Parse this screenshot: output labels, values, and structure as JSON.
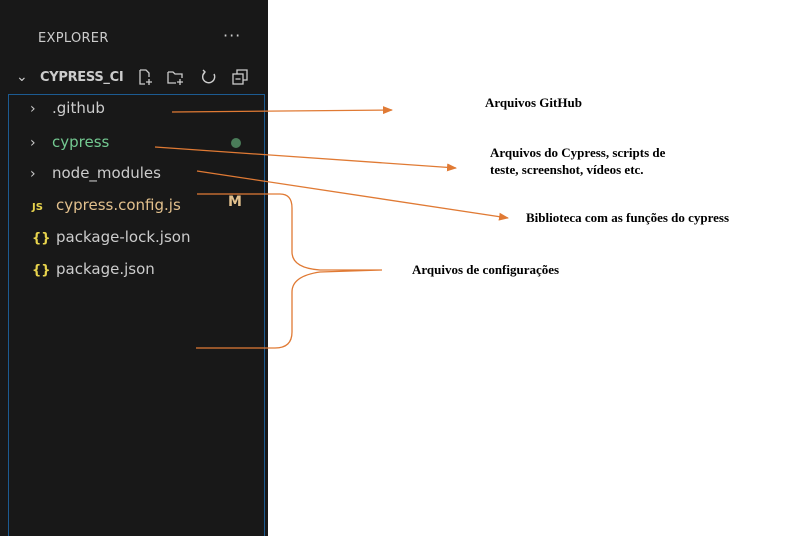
{
  "explorer": {
    "title": "EXPLORER",
    "more_icon": "more-icon",
    "workspace": "CYPRESS_CI",
    "actions": [
      "new-file-icon",
      "new-folder-icon",
      "refresh-icon",
      "collapse-all-icon"
    ]
  },
  "tree": {
    "folders": [
      ".github",
      "cypress",
      "node_modules"
    ],
    "files": [
      {
        "badge": "JS",
        "name": "cypress.config.js",
        "status": "M"
      },
      {
        "badge": "{}",
        "name": "package-lock.json"
      },
      {
        "badge": "{}",
        "name": "package.json"
      }
    ]
  },
  "annotations": {
    "github": "Arquivos GitHub",
    "cypress_line1": "Arquivos do Cypress, scripts de",
    "cypress_line2": "teste, screenshot, vídeos etc.",
    "node_modules": "Biblioteca com as funções do cypress",
    "config": "Arquivos de configurações"
  },
  "colors": {
    "panel_bg": "#181818",
    "arrow": "#e07a34",
    "cypress_folder": "#73c991",
    "modified": "#e2c08d",
    "js_badge": "#e8d44d",
    "focus_border": "#1c5b92"
  }
}
